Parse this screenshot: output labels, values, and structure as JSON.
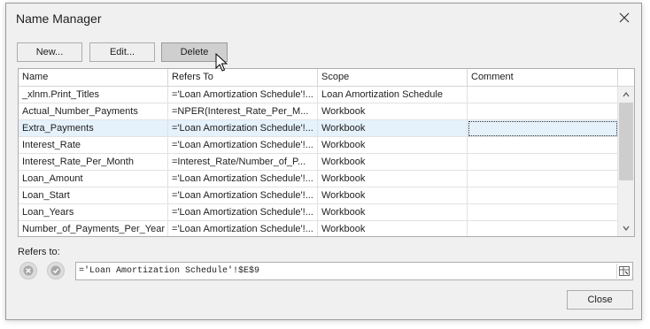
{
  "dialog": {
    "title": "Name Manager",
    "close_icon": "close-icon"
  },
  "toolbar": {
    "new_label": "New...",
    "edit_label": "Edit...",
    "delete_label": "Delete"
  },
  "grid": {
    "columns": [
      "Name",
      "Refers To",
      "Scope",
      "Comment"
    ],
    "rows": [
      {
        "name": "_xlnm.Print_Titles",
        "refers_to": "='Loan Amortization Schedule'!...",
        "scope": "Loan Amortization Schedule",
        "comment": ""
      },
      {
        "name": "Actual_Number_Payments",
        "refers_to": "=NPER(Interest_Rate_Per_M...",
        "scope": "Workbook",
        "comment": ""
      },
      {
        "name": "Extra_Payments",
        "refers_to": "='Loan Amortization Schedule'!...",
        "scope": "Workbook",
        "comment": ""
      },
      {
        "name": "Interest_Rate",
        "refers_to": "='Loan Amortization Schedule'!...",
        "scope": "Workbook",
        "comment": ""
      },
      {
        "name": "Interest_Rate_Per_Month",
        "refers_to": "=Interest_Rate/Number_of_P...",
        "scope": "Workbook",
        "comment": ""
      },
      {
        "name": "Loan_Amount",
        "refers_to": "='Loan Amortization Schedule'!...",
        "scope": "Workbook",
        "comment": ""
      },
      {
        "name": "Loan_Start",
        "refers_to": "='Loan Amortization Schedule'!...",
        "scope": "Workbook",
        "comment": ""
      },
      {
        "name": "Loan_Years",
        "refers_to": "='Loan Amortization Schedule'!...",
        "scope": "Workbook",
        "comment": ""
      },
      {
        "name": "Number_of_Payments_Per_Year",
        "refers_to": "='Loan Amortization Schedule'!...",
        "scope": "Workbook",
        "comment": ""
      }
    ],
    "selected_row": 2
  },
  "refers": {
    "label": "Refers to:",
    "value": "='Loan Amortization Schedule'!$E$9",
    "cancel_icon": "cancel-icon",
    "confirm_icon": "check-icon",
    "range_icon": "range-picker-icon"
  },
  "footer": {
    "close_label": "Close"
  },
  "colors": {
    "selected_row": "#e5f1fb",
    "hover_button": "#cfcfcf",
    "dialog_bg": "#f0f0f0"
  }
}
